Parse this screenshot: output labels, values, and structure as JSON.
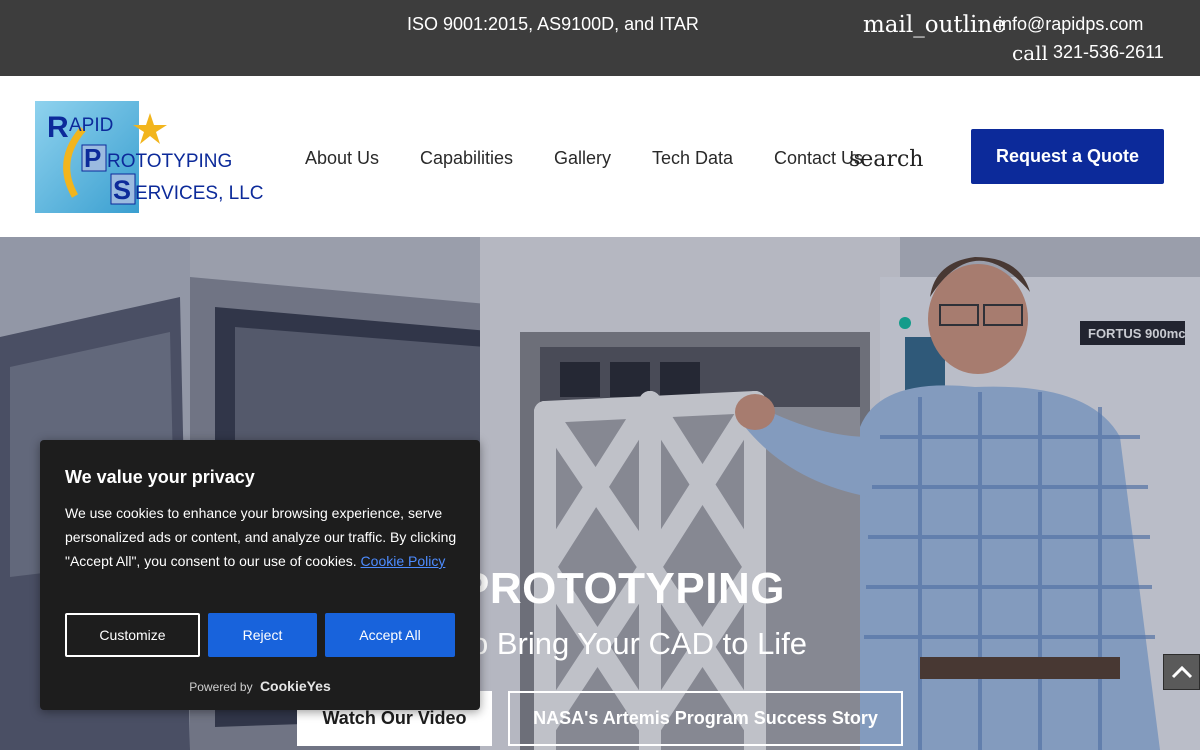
{
  "topbar": {
    "certifications": "ISO 9001:2015, AS9100D, and ITAR",
    "mail_icon": "mail_outline",
    "email": "info@rapidps.com",
    "call_icon": "call",
    "phone": "321-536-2611"
  },
  "header": {
    "logo": {
      "lines": [
        "RAPID",
        "PROTOTYPING",
        "SERVICES, LLC"
      ],
      "brand_color": "#0c2a9a",
      "accent_color": "#f2b51d"
    },
    "nav": [
      {
        "label": "About Us"
      },
      {
        "label": "Capabilities"
      },
      {
        "label": "Gallery"
      },
      {
        "label": "Tech Data"
      },
      {
        "label": "Contact Us"
      }
    ],
    "search_icon": "search",
    "quote_button": "Request a Quote",
    "quote_color": "#0c2a9a"
  },
  "hero": {
    "title": "D PROTOTYPING",
    "subtitle": "Way to Bring Your CAD to Life",
    "watch_video": "Watch Our Video",
    "nasa_story": "NASA's Artemis Program Success Story",
    "machine_label": "FORTUS 900mc"
  },
  "cookie": {
    "title": "We value your privacy",
    "body": "We use cookies to enhance your browsing experience, serve personalized ads or content, and analyze our traffic. By clicking \"Accept All\", you consent to our use of cookies.",
    "policy_link": "Cookie Policy",
    "customize": "Customize",
    "reject": "Reject",
    "accept_all": "Accept All",
    "powered_by": "Powered by",
    "brand": "CookieYes",
    "button_color": "#1863dc"
  }
}
